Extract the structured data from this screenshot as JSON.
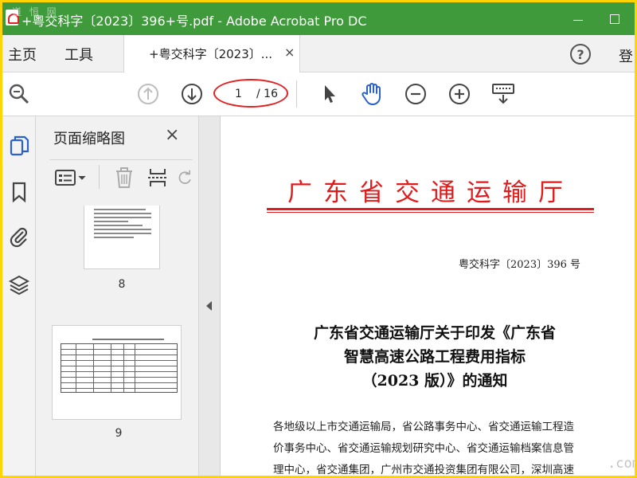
{
  "window": {
    "title": "+粤交科字〔2023〕396+号.pdf - Adobe Acrobat Pro DC",
    "watermark": "道 恒 网"
  },
  "menu": {
    "home": "主页",
    "tools": "工具",
    "doc_tab_label": "+粤交科字〔2023〕...",
    "doc_tab_close": "×",
    "help": "?",
    "login": "登"
  },
  "toolbar": {
    "page_current": "1",
    "page_total": "/ 16"
  },
  "thumbnails_panel": {
    "title": "页面缩略图",
    "close": "×",
    "pages": [
      {
        "label": "8"
      },
      {
        "label": "9"
      }
    ]
  },
  "document": {
    "header": "广东省交通运输厅",
    "reference": "粤交科字〔2023〕396 号",
    "title_lines": [
      "广东省交通运输厅关于印发《广东省",
      "智慧高速公路工程费用指标",
      "（2023 版）》的通知"
    ],
    "body_lines": [
      "各地级以上市交通运输局，省公路事务中心、省交通运输工程造",
      "价事务中心、省交通运输规划研究中心、省交通运输档案信息管",
      "理中心，省交通集团，广州市交通投资集团有限公司，深圳高速"
    ],
    "site_watermark": ".com"
  },
  "colors": {
    "titlebar": "#3e9a3a",
    "doc_red": "#e01b1b",
    "highlight_ellipse": "#e32020",
    "icon_blue": "#2a62c9"
  },
  "icons": [
    "pdf-app-icon",
    "minimize-icon",
    "maximize-icon",
    "help-icon",
    "search-zoom-icon",
    "page-up-icon",
    "page-down-icon",
    "select-cursor-icon",
    "hand-tool-icon",
    "zoom-out-icon",
    "zoom-in-icon",
    "keyboard-icon",
    "page-thumbnails-icon",
    "bookmark-icon",
    "attachment-icon",
    "layers-icon",
    "options-menu-icon",
    "trash-icon",
    "crop-icon",
    "rotate-icon"
  ]
}
